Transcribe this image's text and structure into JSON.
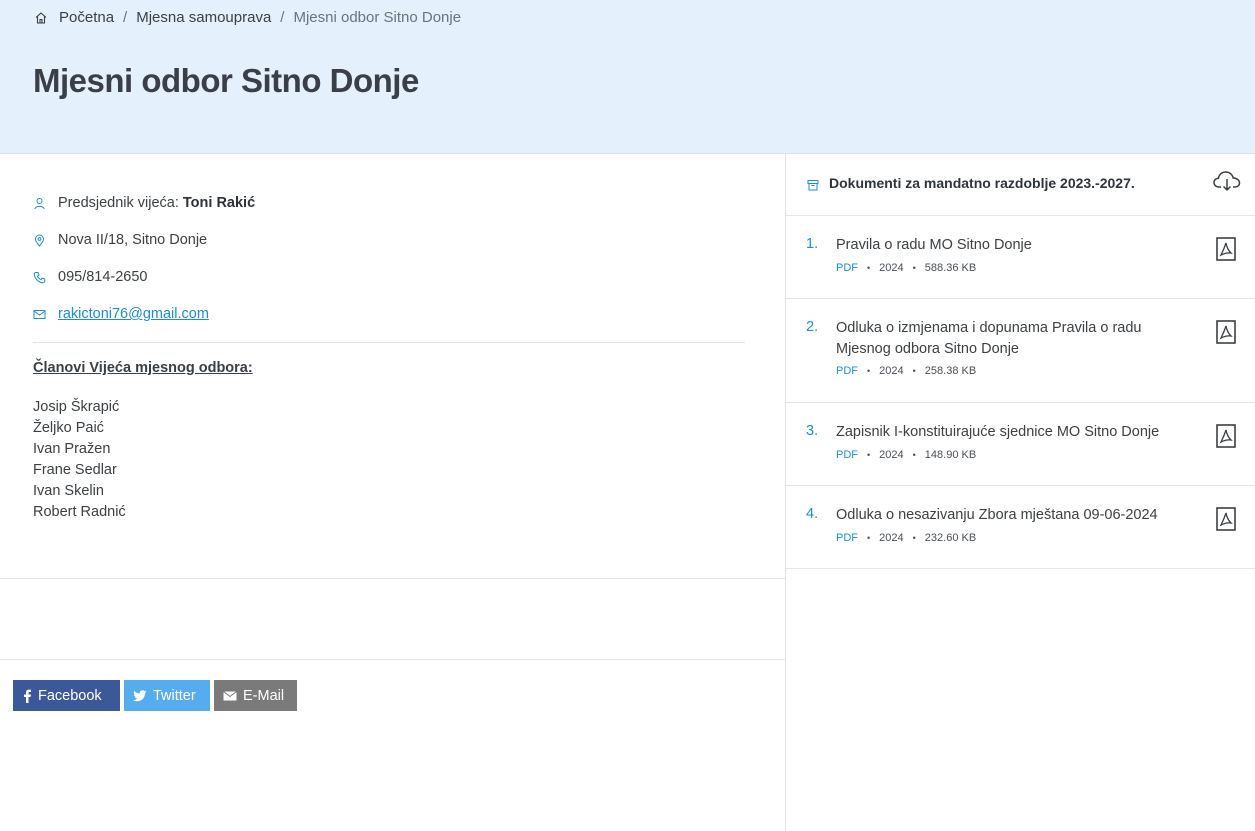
{
  "breadcrumb": {
    "home": "Početna",
    "section": "Mjesna samouprava",
    "current": "Mjesni odbor Sitno Donje",
    "separator": "/"
  },
  "page": {
    "title": "Mjesni odbor Sitno Donje"
  },
  "contact": {
    "president_label": "Predsjednik vijeća:",
    "president_name": "Toni Rakić",
    "address": "Nova II/18, Sitno Donje",
    "phone": "095/814-2650",
    "email": "rakictoni76@gmail.com"
  },
  "members": {
    "title": "Članovi Vijeća mjesnog odbora:",
    "list": [
      "Josip Škrapić",
      "Željko Paić",
      "Ivan Pražen",
      "Frane Sedlar",
      "Ivan Skelin",
      "Robert Radnić"
    ]
  },
  "share": {
    "facebook": "Facebook",
    "twitter": "Twitter",
    "email": "E-Mail"
  },
  "documents": {
    "title": "Dokumenti za mandatno razdoblje 2023.-2027.",
    "items": [
      {
        "num": "1.",
        "name": "Pravila o radu MO Sitno Donje",
        "format": "PDF",
        "year": "2024",
        "size": "588.36 KB"
      },
      {
        "num": "2.",
        "name": "Odluka o izmjenama i dopunama Pravila o radu Mjesnog odbora Sitno Donje",
        "format": "PDF",
        "year": "2024",
        "size": "258.38 KB"
      },
      {
        "num": "3.",
        "name": "Zapisnik I-konstituirajuće sjednice MO Sitno Donje",
        "format": "PDF",
        "year": "2024",
        "size": "148.90 KB"
      },
      {
        "num": "4.",
        "name": "Odluka o nesazivanju Zbora mještana 09-06-2024",
        "format": "PDF",
        "year": "2024",
        "size": "232.60 KB"
      }
    ]
  },
  "colors": {
    "accent": "#1a8fd6",
    "hero_bg": "#e4f0fb",
    "facebook": "#3b5998",
    "twitter": "#55acee",
    "email": "#7a7a7a"
  },
  "icons": [
    "home-icon",
    "user-icon",
    "map-pin-icon",
    "phone-icon",
    "mail-icon",
    "archive-icon",
    "cloud-download-icon",
    "pdf-icon",
    "facebook-icon",
    "twitter-icon",
    "envelope-icon"
  ]
}
